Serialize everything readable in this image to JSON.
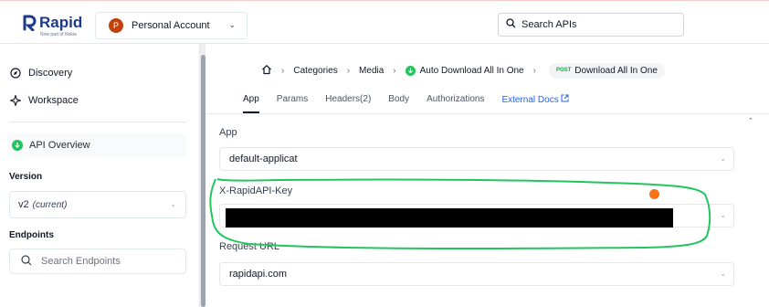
{
  "brand": {
    "name": "Rapid",
    "tagline": "Now part of Nokia",
    "color": "#1e3a8a"
  },
  "account": {
    "avatar_letter": "P",
    "label": "Personal Account"
  },
  "search_apis": {
    "placeholder": "Search APIs"
  },
  "sidebar": {
    "nav": [
      {
        "label": "Discovery",
        "icon": "compass-icon"
      },
      {
        "label": "Workspace",
        "icon": "sparkle-icon"
      }
    ],
    "overview_label": "API Overview",
    "version_title": "Version",
    "version_value": "v2",
    "version_note": "(current)",
    "endpoints_title": "Endpoints",
    "endpoints_search_placeholder": "Search Endpoints"
  },
  "breadcrumb": {
    "items": [
      "Categories",
      "Media",
      "Auto Download All In One"
    ],
    "method": "POST",
    "current": "Download All In One"
  },
  "tabs": [
    {
      "label": "App",
      "active": true
    },
    {
      "label": "Params"
    },
    {
      "label": "Headers(2)"
    },
    {
      "label": "Body"
    },
    {
      "label": "Authorizations"
    },
    {
      "label": "External Docs",
      "link": true
    }
  ],
  "form": {
    "app_label": "App",
    "app_value": "default-applicat",
    "key_label": "X-RapidAPI-Key",
    "key_value": "",
    "request_url_label": "Request URL",
    "request_url_value": "rapidapi.com"
  },
  "colors": {
    "accent_green": "#22c55e",
    "highlight_green": "#22c55e",
    "marker_orange": "#f97316",
    "link": "#2563eb"
  }
}
